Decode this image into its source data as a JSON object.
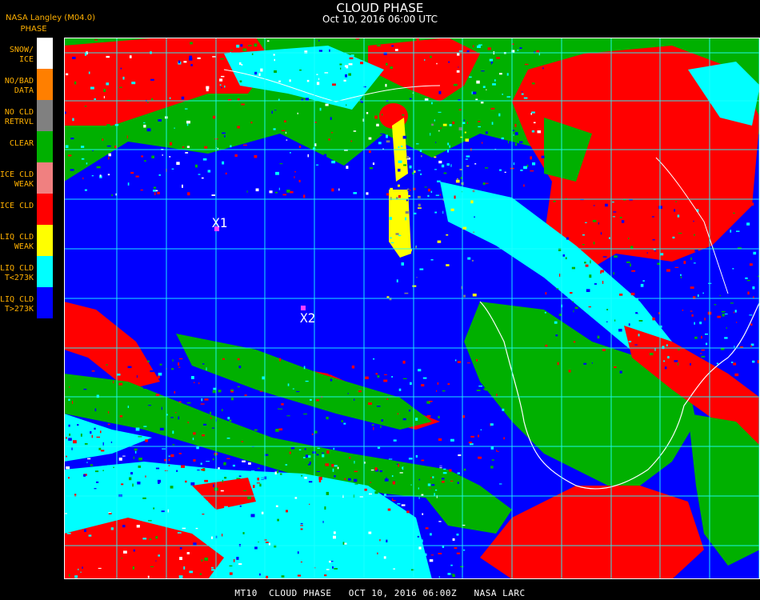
{
  "brand": {
    "line1": "NASA Langley (M04.0)",
    "line2": "PHASE"
  },
  "header": {
    "title": "CLOUD PHASE",
    "subtitle": "Oct 10, 2016 06:00 UTC"
  },
  "legend": [
    {
      "label": "SNOW/\nICE",
      "color": "#ffffff"
    },
    {
      "label": "NO/BAD\nDATA",
      "color": "#ff7f00"
    },
    {
      "label": "NO CLD\nRETRVL",
      "color": "#808080"
    },
    {
      "label": "CLEAR",
      "color": "#00b000"
    },
    {
      "label": "ICE CLD\nWEAK",
      "color": "#f08080"
    },
    {
      "label": "ICE CLD",
      "color": "#ff0000"
    },
    {
      "label": "LIQ CLD\nWEAK",
      "color": "#ffff00"
    },
    {
      "label": "LIQ CLD\nT<273K",
      "color": "#00ffff"
    },
    {
      "label": "LIQ CLD\nT>273K",
      "color": "#0000ff"
    }
  ],
  "markers": [
    {
      "label": "X1"
    },
    {
      "label": "X2"
    }
  ],
  "colors": {
    "background": "#000000",
    "grid": "#20ffff",
    "text": "#ffffff",
    "legend_text": "#ffb000",
    "coast": "#ffffff",
    "marker": "#ff40ff"
  },
  "footer": {
    "caption": "MT10  CLOUD PHASE   OCT 10, 2016 06:00Z   NASA LARC"
  }
}
